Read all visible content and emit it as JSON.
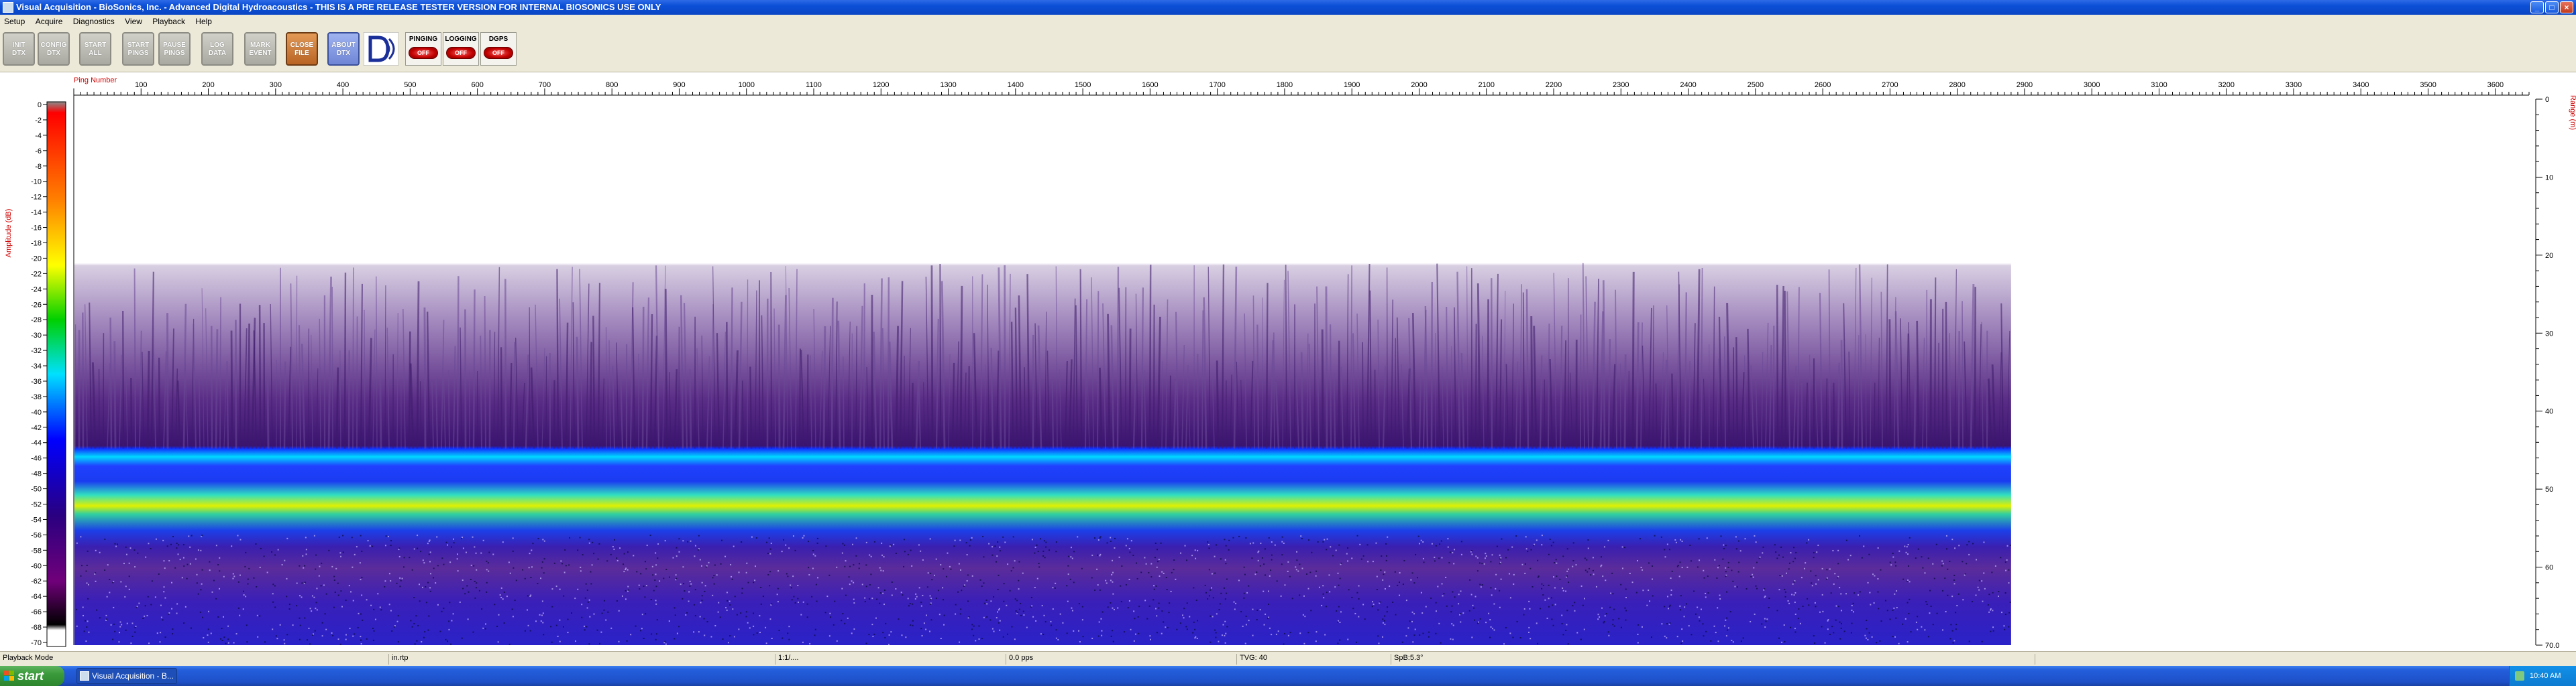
{
  "window": {
    "title": "Visual Acquisition  -  BioSonics, Inc.  -  Advanced Digital Hydroacoustics  -  THIS IS A PRE RELEASE TESTER VERSION FOR INTERNAL BIOSONICS USE ONLY",
    "buttons": [
      "minimize",
      "maximize",
      "close"
    ]
  },
  "menu": [
    "Setup",
    "Acquire",
    "Diagnostics",
    "View",
    "Playback",
    "Help"
  ],
  "toolbar": {
    "buttons": [
      {
        "line1": "INIT",
        "line2": "DTX",
        "style": "gray"
      },
      {
        "line1": "CONFIG",
        "line2": "DTX",
        "style": "gray"
      },
      {
        "line1": "START",
        "line2": "ALL",
        "style": "gray"
      },
      {
        "line1": "START",
        "line2": "PINGS",
        "style": "gray"
      },
      {
        "line1": "PAUSE",
        "line2": "PINGS",
        "style": "gray"
      },
      {
        "line1": "LOG",
        "line2": "DATA",
        "style": "gray"
      },
      {
        "line1": "MARK",
        "line2": "EVENT",
        "style": "gray"
      },
      {
        "line1": "CLOSE",
        "line2": "FILE",
        "style": "orange"
      },
      {
        "line1": "ABOUT",
        "line2": "DTX",
        "style": "blue"
      }
    ],
    "indicators": [
      {
        "label": "PINGING",
        "state": "OFF"
      },
      {
        "label": "LOGGING",
        "state": "OFF"
      },
      {
        "label": "DGPS",
        "state": "OFF"
      }
    ]
  },
  "plot": {
    "x_axis_label": "Ping Number",
    "y_axis_left_label": "Amplitude (dB)",
    "y_axis_right_label": "Range (m)",
    "x_ticks": [
      "100",
      "200",
      "300",
      "400",
      "500",
      "600",
      "700",
      "800",
      "900",
      "1000",
      "1100",
      "1200",
      "1300",
      "1400",
      "1500",
      "1600",
      "1700",
      "1800",
      "1900",
      "2000",
      "2100",
      "2200",
      "2300",
      "2400",
      "2500",
      "2600",
      "2700",
      "2800",
      "2900",
      "3000",
      "3100",
      "3200",
      "3300",
      "3400",
      "3500",
      "3600"
    ],
    "range_ticks": [
      "0",
      "10",
      "20",
      "30",
      "40",
      "50",
      "60",
      "70.0"
    ],
    "colorbar_ticks": [
      "0",
      "-2",
      "-4",
      "-6",
      "-8",
      "-10",
      "-12",
      "-14",
      "-16",
      "-18",
      "-20",
      "-22",
      "-24",
      "-26",
      "-28",
      "-30",
      "-32",
      "-34",
      "-36",
      "-38",
      "-40",
      "-42",
      "-44",
      "-46",
      "-48",
      "-50",
      "-52",
      "-54",
      "-56",
      "-58",
      "-60",
      "-62",
      "-64",
      "-66",
      "-68",
      "-70"
    ],
    "x_range": [
      0,
      3650
    ],
    "range_limits": [
      0,
      70
    ],
    "db_range": [
      0,
      -70
    ],
    "data_extent_pings": 2880
  },
  "status": {
    "cells": [
      "Playback Mode",
      "in.rtp",
      "1:1/....",
      "0.0 pps",
      "TVG: 40",
      "SpB:5.3°"
    ]
  },
  "taskbar": {
    "start": "start",
    "task": "Visual Acquisition  -  B...",
    "clock": "10:40 AM"
  }
}
